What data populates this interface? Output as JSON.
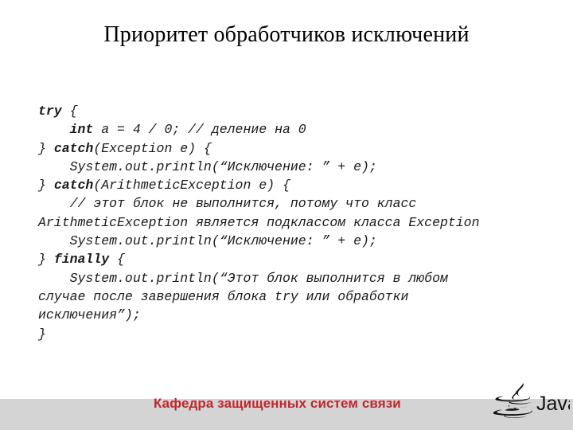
{
  "slide": {
    "title": "Приоритет обработчиков исключений",
    "background_color": "#ffffff",
    "code": {
      "language": "java",
      "lines": [
        {
          "keyword": "try",
          "rest": " {"
        },
        {
          "indent": "    ",
          "keyword": "int",
          "rest": " a = 4 / 0; // деление на 0"
        },
        {
          "prefix": "} ",
          "keyword": "catch",
          "rest": "(Exception e) {"
        },
        {
          "indent": "    ",
          "rest": "System.out.println(“Исключение: ” + e);"
        },
        {
          "prefix": "} ",
          "keyword": "catch",
          "rest": "(ArithmeticException e) {"
        },
        {
          "indent": "    ",
          "rest": "// этот блок не выполнится, потому что класс"
        },
        {
          "rest": "ArithmeticException является подклассом класса Exception"
        },
        {
          "indent": "    ",
          "rest": "System.out.println(“Исключение: ” + e);"
        },
        {
          "prefix": "} ",
          "keyword": "finally",
          "rest": " {"
        },
        {
          "indent": "    ",
          "rest": "System.out.println(“Этот блок выполнится в любом"
        },
        {
          "rest": "случае после завершения блока try или обработки"
        },
        {
          "rest": "исключения”);"
        },
        {
          "rest": "}"
        }
      ]
    }
  },
  "footer": {
    "text": "Кафедра защищенных систем связи",
    "text_color": "#c0272d",
    "band_color": "#d4d4d4",
    "logo_name": "java-logo",
    "logo_wordmark": "Java"
  }
}
